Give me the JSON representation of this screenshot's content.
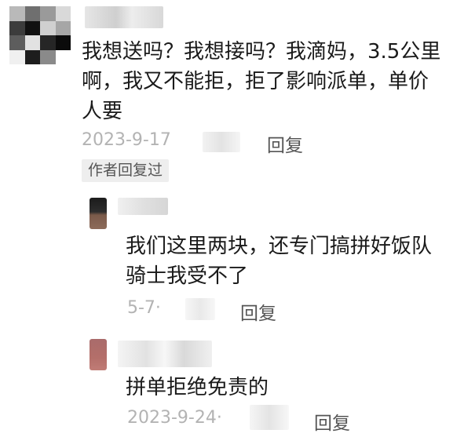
{
  "comments": [
    {
      "text_lines": [
        "我想送吗？我想接吗？我滴妈，3.5公里",
        "啊，我又不能拒，拒了影响派单，单价",
        "人要"
      ],
      "date": "2023-9-17",
      "reply_label": "回复",
      "badge": "作者回复过"
    }
  ],
  "replies": [
    {
      "text_lines": [
        "我们这里两块，还专门搞拼好饭队",
        "骑士我受不了"
      ],
      "date": "5-7·",
      "reply_label": "回复"
    },
    {
      "text_lines": [
        "拼单拒绝免责的"
      ],
      "date": "2023-9-24·",
      "reply_label": "回复"
    }
  ]
}
